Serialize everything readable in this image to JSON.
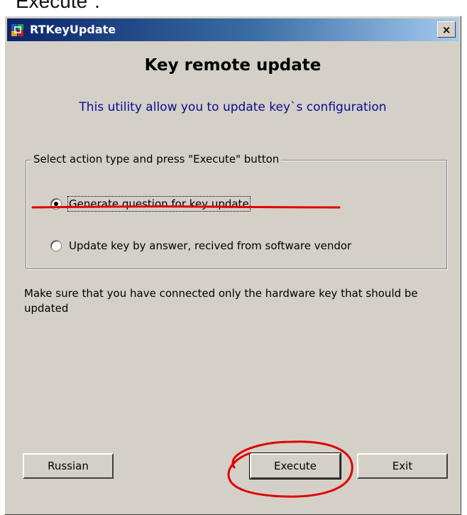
{
  "top_cut_text": "Execute\".",
  "window": {
    "title": "RTKeyUpdate",
    "close_label": "×"
  },
  "heading": "Key remote update",
  "subtitle": "This utility allow you to update key`s configuration",
  "group": {
    "legend": "Select action type and press \"Execute\" button",
    "options": [
      {
        "label": "Generate question for key update",
        "checked": true
      },
      {
        "label": "Update key by answer, recived from software vendor",
        "checked": false
      }
    ]
  },
  "note": "Make sure that you have connected only the hardware key that should be updated",
  "buttons": {
    "russian": "Russian",
    "execute": "Execute",
    "exit": "Exit"
  },
  "colors": {
    "titlebar_start": "#0a246a",
    "titlebar_end": "#a6caf0",
    "window_face": "#d4d0c8",
    "subtitle_text": "#0a0a90",
    "annotation_red": "#e00000"
  },
  "icons": {
    "app": "app-icon",
    "close": "close-icon"
  }
}
